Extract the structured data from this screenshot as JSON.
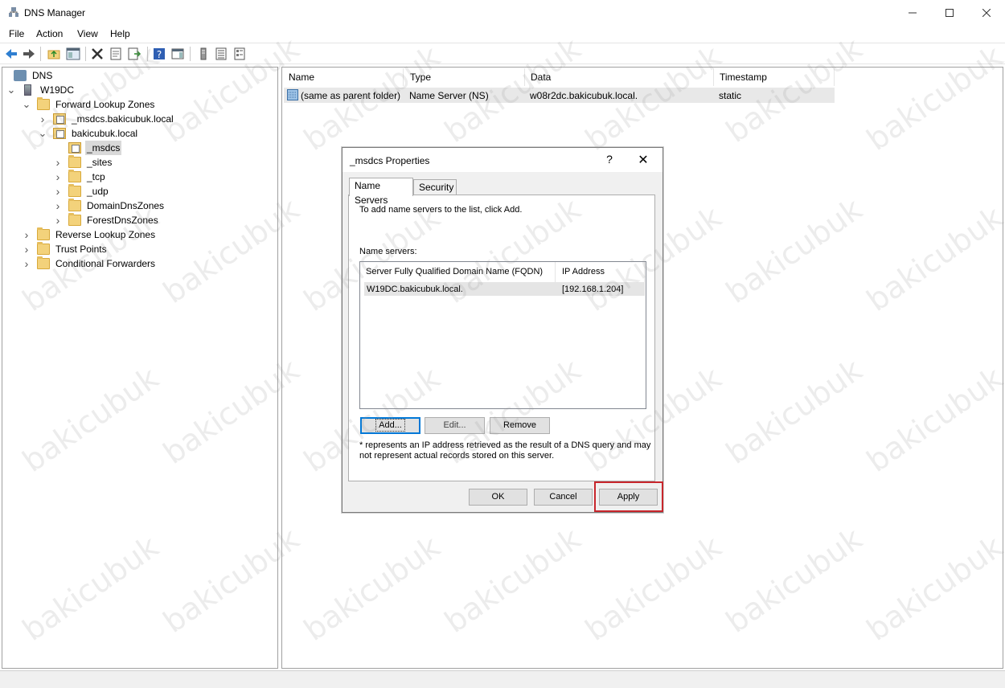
{
  "window": {
    "title": "DNS Manager"
  },
  "menu": [
    "File",
    "Action",
    "View",
    "Help"
  ],
  "tree": [
    {
      "label": "DNS",
      "level": 0,
      "expander": "",
      "icon": "dns-icon"
    },
    {
      "label": "W19DC",
      "level": 0,
      "expander": "expanded",
      "icon": "server-icon"
    },
    {
      "label": "Forward Lookup Zones",
      "level": 1,
      "expander": "expanded",
      "icon": "folder-icon"
    },
    {
      "label": "_msdcs.bakicubuk.local",
      "level": 2,
      "expander": "collapsed",
      "icon": "zone-icon"
    },
    {
      "label": "bakicubuk.local",
      "level": 2,
      "expander": "expanded",
      "icon": "zone-icon"
    },
    {
      "label": "_msdcs",
      "level": 3,
      "expander": "",
      "icon": "delegation-icon",
      "selected": true
    },
    {
      "label": "_sites",
      "level": 3,
      "expander": "collapsed",
      "icon": "folder-icon"
    },
    {
      "label": "_tcp",
      "level": 3,
      "expander": "collapsed",
      "icon": "folder-icon"
    },
    {
      "label": "_udp",
      "level": 3,
      "expander": "collapsed",
      "icon": "folder-icon"
    },
    {
      "label": "DomainDnsZones",
      "level": 3,
      "expander": "collapsed",
      "icon": "folder-icon"
    },
    {
      "label": "ForestDnsZones",
      "level": 3,
      "expander": "collapsed",
      "icon": "folder-icon"
    },
    {
      "label": "Reverse Lookup Zones",
      "level": 1,
      "expander": "collapsed",
      "icon": "folder-icon"
    },
    {
      "label": "Trust Points",
      "level": 1,
      "expander": "collapsed",
      "icon": "folder-icon"
    },
    {
      "label": "Conditional Forwarders",
      "level": 1,
      "expander": "collapsed",
      "icon": "folder-icon"
    }
  ],
  "list": {
    "columns": [
      "Name",
      "Type",
      "Data",
      "Timestamp"
    ],
    "rows": [
      {
        "name": "(same as parent folder)",
        "type": "Name Server (NS)",
        "data": "w08r2dc.bakicubuk.local.",
        "timestamp": "static"
      }
    ]
  },
  "dialog": {
    "title": "_msdcs Properties",
    "help": "?",
    "close": "✕",
    "tabs": [
      "Name Servers",
      "Security"
    ],
    "active_tab": "Name Servers",
    "instruction": "To add name servers to the list, click Add.",
    "list_label": "Name servers:",
    "ns_columns": [
      "Server Fully Qualified Domain Name (FQDN)",
      "IP Address"
    ],
    "ns_rows": [
      {
        "fqdn": "W19DC.bakicubuk.local.",
        "ip": "[192.168.1.204]"
      }
    ],
    "buttons": {
      "add": "Add...",
      "edit": "Edit...",
      "remove": "Remove",
      "ok": "OK",
      "cancel": "Cancel",
      "apply": "Apply"
    },
    "note_line1": "* represents an IP address retrieved as the result of a DNS query and may",
    "note_line2": "not represent actual records stored on this server."
  },
  "watermark": "bakicubuk",
  "colors": {
    "highlight": "#c8262c",
    "default_button": "#0078d7"
  }
}
